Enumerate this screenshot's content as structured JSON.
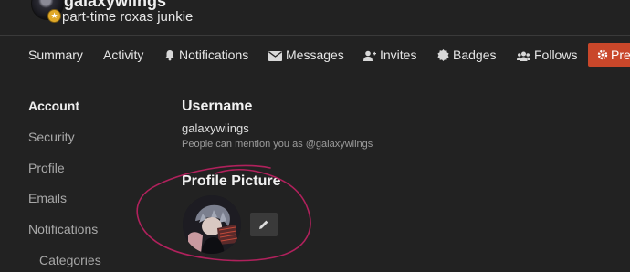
{
  "header": {
    "username": "galaxywiings",
    "user_title": "part-time roxas junkie"
  },
  "nav": {
    "items": [
      {
        "label": "Summary",
        "icon": null
      },
      {
        "label": "Activity",
        "icon": null
      },
      {
        "label": "Notifications",
        "icon": "bell-icon"
      },
      {
        "label": "Messages",
        "icon": "envelope-icon"
      },
      {
        "label": "Invites",
        "icon": "user-plus-icon"
      },
      {
        "label": "Badges",
        "icon": "badge-certificate-icon"
      },
      {
        "label": "Follows",
        "icon": "users-icon"
      }
    ],
    "preferences_label": "Pre"
  },
  "sidebar": {
    "items": [
      {
        "label": "Account",
        "active": true
      },
      {
        "label": "Security"
      },
      {
        "label": "Profile"
      },
      {
        "label": "Emails"
      },
      {
        "label": "Notifications"
      },
      {
        "label": "Categories"
      }
    ]
  },
  "main": {
    "username_heading": "Username",
    "username_value": "galaxywiings",
    "mention_hint": "People can mention you as @galaxywiings",
    "profile_picture_heading": "Profile Picture"
  },
  "colors": {
    "background": "#222222",
    "accent": "#c9472a",
    "annotation": "#b0215c"
  }
}
